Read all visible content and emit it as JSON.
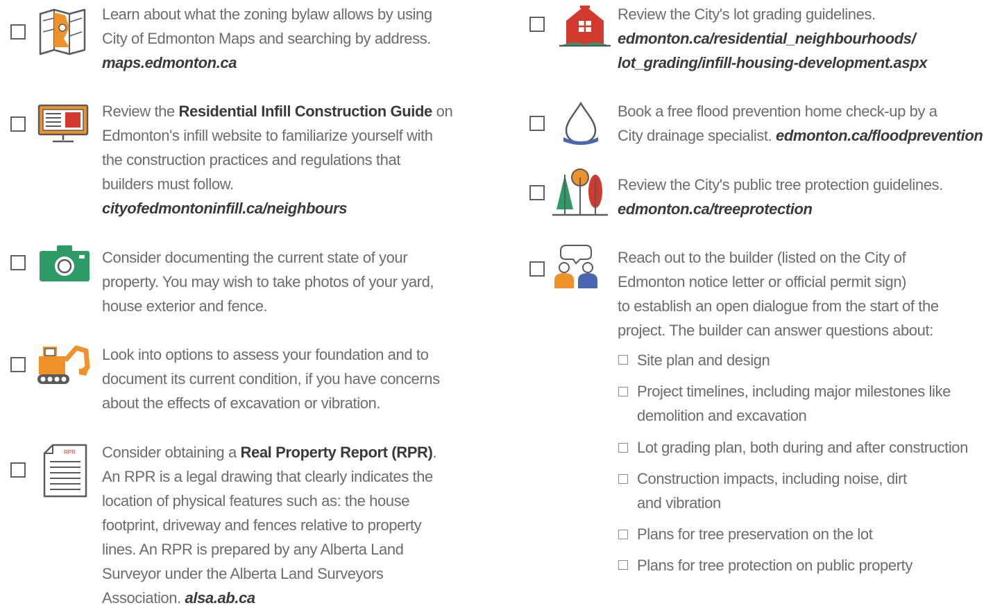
{
  "left_items": [
    {
      "lines": [
        "Learn about what the zoning bylaw allows by using",
        "City of Edmonton Maps and searching by address."
      ],
      "url": "maps.edmonton.ca"
    },
    {
      "line1_pre": "Review the ",
      "line1_strong": "Residential Infill Construction Guide",
      "line1_post": " on",
      "lines": [
        "Edmonton's infill website to familiarize yourself with",
        "the construction practices and regulations that",
        "builders must follow."
      ],
      "url": "cityofedmontoninfill.ca/neighbours"
    },
    {
      "lines": [
        "Consider documenting the current state of your",
        "property.  You may wish to take photos of your yard,",
        "house exterior and fence."
      ]
    },
    {
      "lines": [
        "Look into options to assess your foundation and to",
        "document its current condition, if you have concerns",
        "about the effects of excavation or vibration."
      ]
    },
    {
      "line1_pre": "Consider obtaining a ",
      "line1_strong": "Real Property Report (RPR)",
      "line1_post": ".",
      "lines": [
        "An RPR is a legal drawing that clearly indicates the",
        "location of physical features such as: the house",
        "footprint, driveway and fences relative to property",
        "lines. An RPR is prepared by any Alberta Land",
        "Surveyor under the Alberta Land Surveyors"
      ],
      "last_pre": "Association. ",
      "url": "alsa.ab.ca",
      "icon_label": "RPR"
    }
  ],
  "right_items": [
    {
      "lines": [
        "Review the City's lot grading guidelines."
      ],
      "url_lines": [
        "edmonton.ca/residential_neighbourhoods/",
        "lot_grading/infill-housing-development.aspx"
      ]
    },
    {
      "lines": [
        "Book a free flood prevention home check-up by a"
      ],
      "last_pre": "City drainage specialist. ",
      "url": "edmonton.ca/floodprevention"
    },
    {
      "lines": [
        "Review the City's public tree protection guidelines."
      ],
      "url": "edmonton.ca/treeprotection"
    },
    {
      "lines": [
        "Reach out to the builder (listed on the City of",
        "Edmonton notice letter or official permit sign)",
        "to establish an open dialogue from the start of the",
        "project. The builder can answer questions about:"
      ],
      "subitems": [
        [
          "Site plan and design"
        ],
        [
          "Project timelines, including major milestones like",
          "demolition and excavation"
        ],
        [
          "Lot grading plan, both during and after construction"
        ],
        [
          "Construction impacts, including noise, dirt",
          "and vibration"
        ],
        [
          "Plans for tree preservation on the lot"
        ],
        [
          "Plans for tree protection on public property"
        ]
      ]
    }
  ],
  "icons": [
    "map-icon",
    "monitor-icon",
    "camera-icon",
    "excavator-icon",
    "document-icon",
    "house-icon",
    "water-drop-icon",
    "trees-icon",
    "people-icon"
  ],
  "colors": {
    "orange": "#f0922b",
    "red": "#d23a2e",
    "green": "#2e9a66",
    "blue": "#4a68b0",
    "text": "#6c6c6c",
    "link": "#3a3a3a"
  }
}
